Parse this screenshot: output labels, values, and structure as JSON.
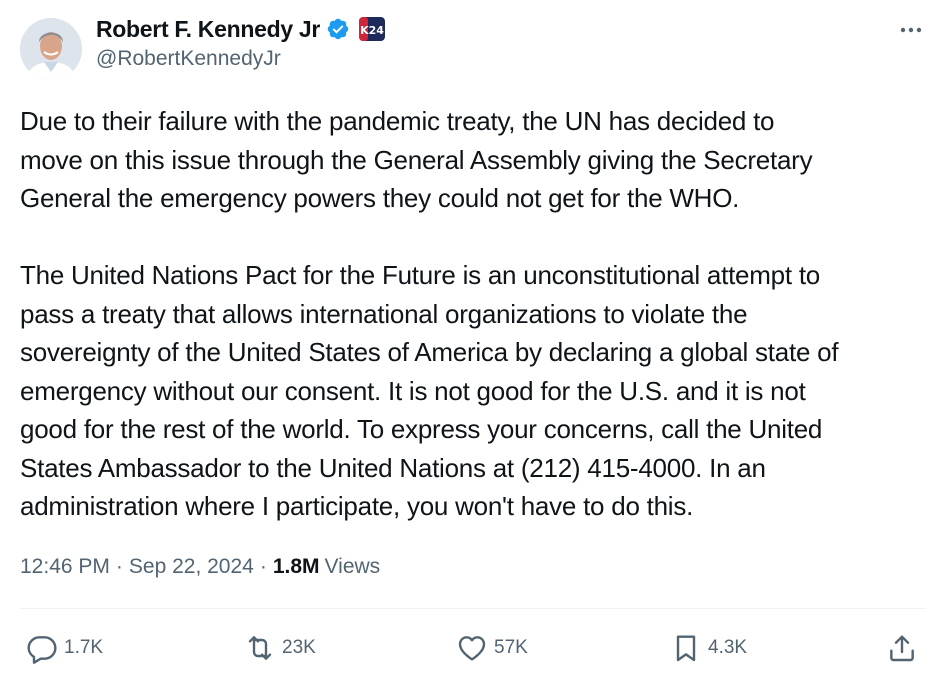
{
  "author": {
    "display_name": "Robert F. Kennedy Jr",
    "handle": "@RobertKennedyJr",
    "verified_color": "#1d9bf0",
    "affiliation_badge_text": "K24"
  },
  "tweet": {
    "text": "Due to their failure with the pandemic treaty, the UN has decided to\nmove on this issue through the General Assembly giving the Secretary\nGeneral the emergency powers they could not get for the WHO.\n\nThe United Nations Pact for the Future is an unconstitutional attempt to\npass a treaty that allows international organizations to violate the\nsovereignty of the United States of America by declaring a global state of\nemergency without our consent. It is not good for the U.S. and it is not\ngood for the rest of the world. To express your concerns, call the United\nStates Ambassador to the United Nations at (212) 415-4000. In an\nadministration where I participate, you won't have to do this.",
    "time": "12:46 PM",
    "date": "Sep 22, 2024",
    "views_count": "1.8M",
    "views_label": "Views",
    "separator": "·"
  },
  "actions": {
    "replies": "1.7K",
    "reposts": "23K",
    "likes": "57K",
    "bookmarks": "4.3K"
  },
  "icons": [
    "verified-icon",
    "affiliation-badge-icon",
    "more-icon",
    "reply-icon",
    "repost-icon",
    "like-icon",
    "bookmark-icon",
    "share-icon"
  ]
}
